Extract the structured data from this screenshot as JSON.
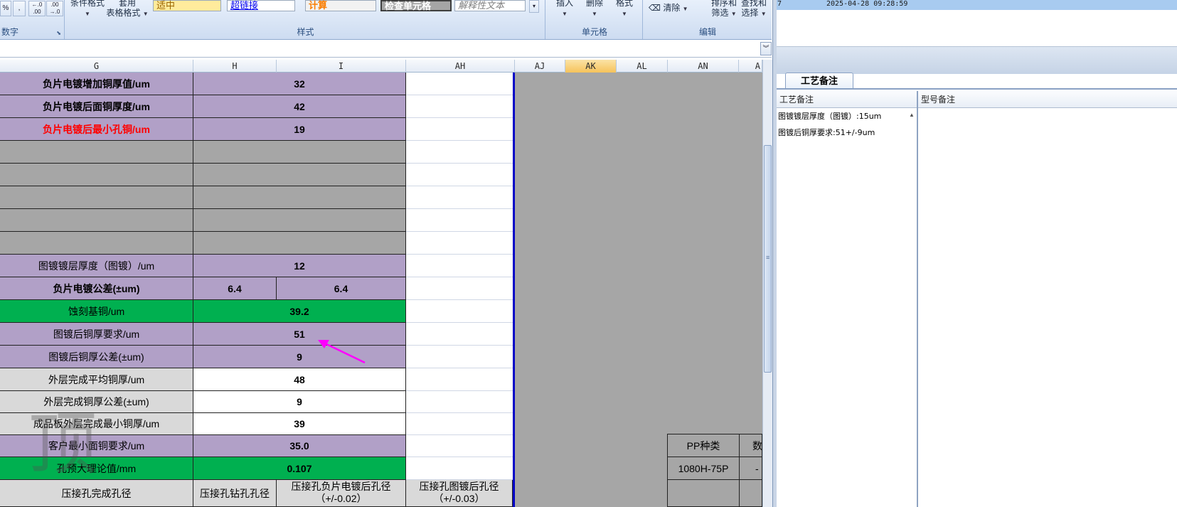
{
  "ribbon": {
    "number_group": {
      "percent": "%",
      "comma": ",",
      "inc_decimal": "←.0 .00",
      "dec_decimal": ".00 →.0",
      "label": "数字"
    },
    "styles_group": {
      "conditional_format": "条件格式",
      "table_style": "套用",
      "table_format": "表格格式",
      "style_neutral": "适中",
      "style_hyperlink": "超链接",
      "style_calc": "计算",
      "style_check": "检查单元格",
      "style_explain": "解释性文本",
      "label": "样式"
    },
    "cells_group": {
      "insert": "插入",
      "delete": "删除",
      "format": "格式",
      "label": "单元格"
    },
    "editing_group": {
      "clear": "清除",
      "sort_filter_1": "排序和",
      "sort_filter_2": "筛选",
      "find_select_1": "查找和",
      "find_select_2": "选择",
      "label": "编辑"
    }
  },
  "columns": [
    "G",
    "H",
    "I",
    "AH",
    "AJ",
    "AK",
    "AL",
    "AN",
    "A"
  ],
  "rows": [
    {
      "label": "负片电镀增加铜厚值/um",
      "value": "32"
    },
    {
      "label": "负片电镀后面铜厚度/um",
      "value": "42"
    },
    {
      "label": "负片电镀后最小孔铜/um",
      "value": "19"
    },
    {
      "label": "图镀镀层厚度（图镀）/um",
      "value": "12"
    },
    {
      "label": "负片电镀公差(±um)",
      "value_h": "6.4",
      "value_i": "6.4"
    },
    {
      "label": "蚀刻基铜/um",
      "value": "39.2"
    },
    {
      "label": "图镀后铜厚要求/um",
      "value": "51"
    },
    {
      "label": "图镀后铜厚公差(±um)",
      "value": "9"
    },
    {
      "label": "外层完成平均铜厚/um",
      "value": "48"
    },
    {
      "label": "外层完成铜厚公差(±um)",
      "value": "9"
    },
    {
      "label": "成品板外层完成最小铜厚/um",
      "value": "39"
    },
    {
      "label": "客户最小面铜要求/um",
      "value": "35.0"
    },
    {
      "label": "孔预大理论值/mm",
      "value": "0.107"
    },
    {
      "label": "压接孔完成孔径",
      "value_h": "压接孔钻孔孔径",
      "value_i": "压接孔负片电镀后孔径（+/-0.02）",
      "value_ah": "压接孔图镀后孔径（+/-0.03）"
    }
  ],
  "pp_table": {
    "header": "PP种类",
    "header2": "数",
    "value": "1080H-75P",
    "value2": "-"
  },
  "watermark": "顶",
  "right_pane": {
    "top_row_id": "7",
    "top_row_time": "2025-04-28 09:28:59",
    "tab": "工艺备注",
    "col1": "工艺备注",
    "col2": "型号备注",
    "notes": [
      "图镀镀层厚度（图镀）:15um",
      "图镀后铜厚要求:51+/-9um"
    ]
  },
  "colors": {
    "purple": "#b1a0c7",
    "green": "#00b050",
    "grey": "#a6a6a6",
    "red_text": "#ff0000",
    "arrow": "#ff00ff",
    "selected_col": "#f6c35b"
  }
}
